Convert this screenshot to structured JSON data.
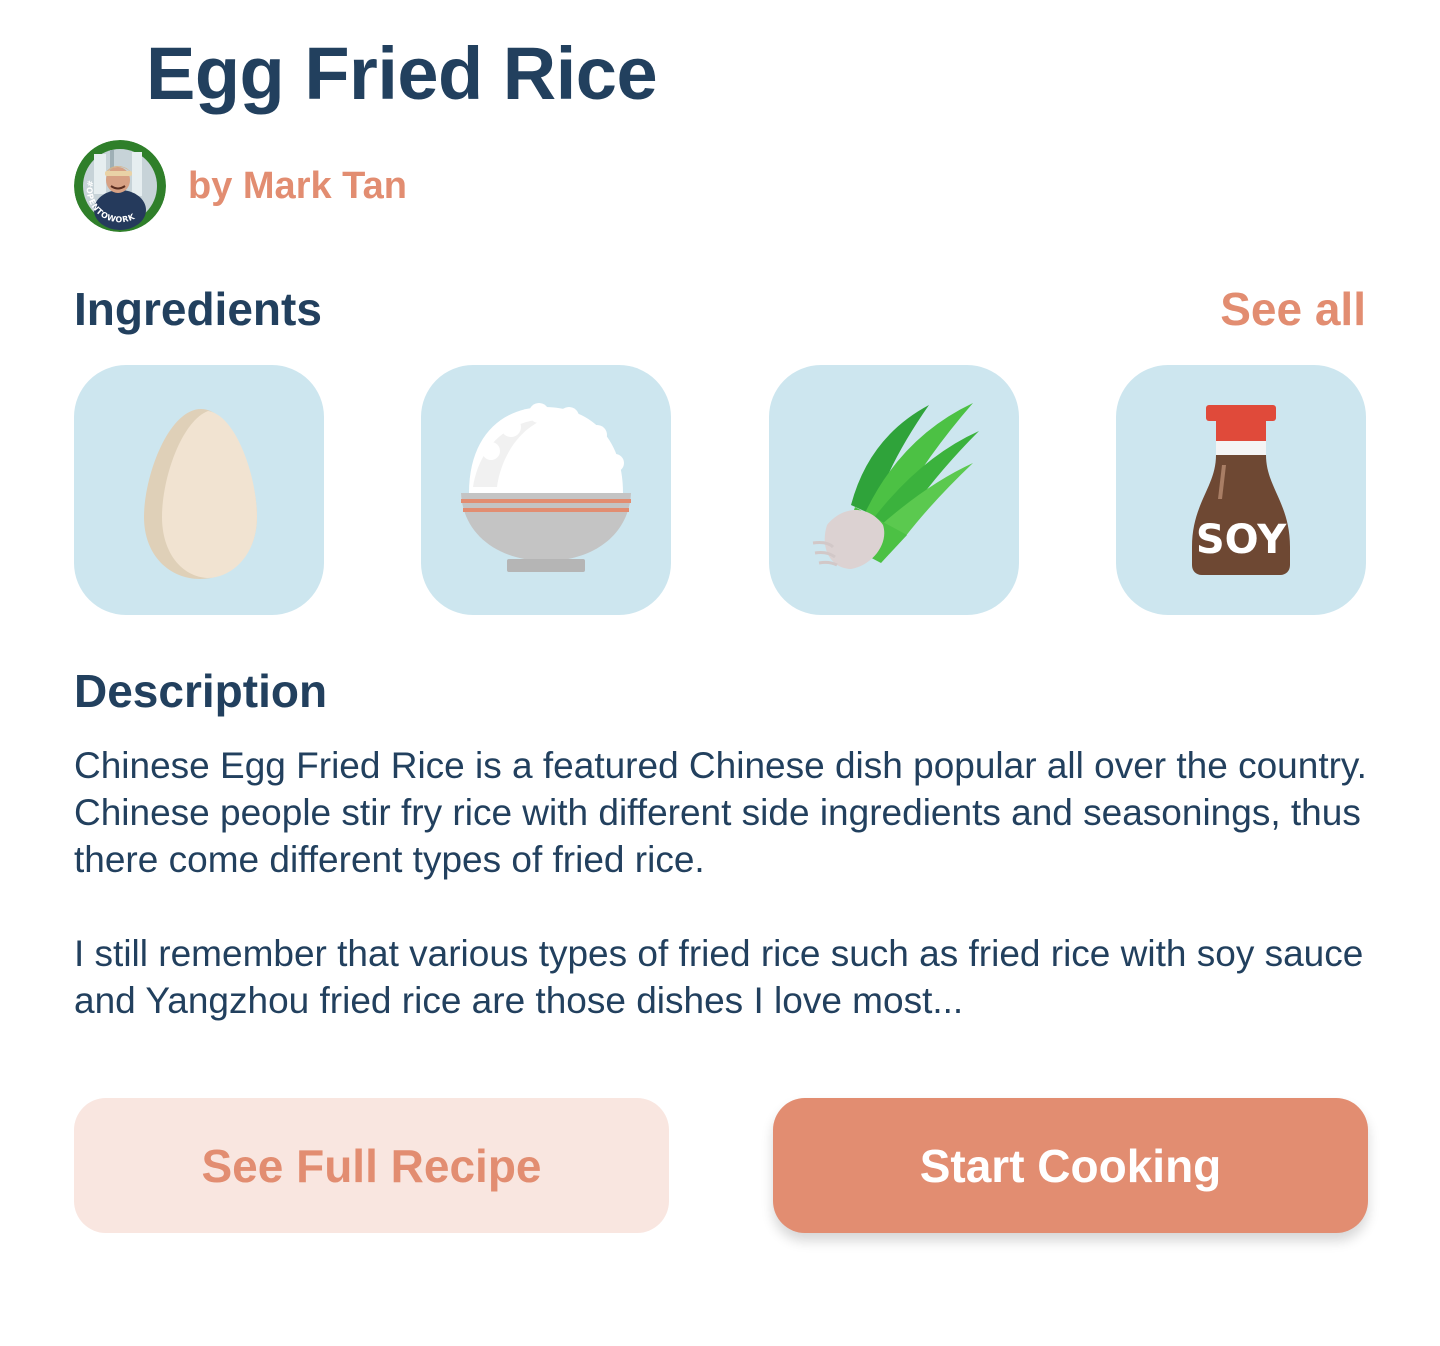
{
  "recipe": {
    "title": "Egg Fried Rice",
    "author": "by Mark Tan",
    "avatar_badge": "#OPENTOWORK"
  },
  "ingredients": {
    "heading": "Ingredients",
    "see_all": "See all",
    "items": [
      {
        "icon": "egg-icon"
      },
      {
        "icon": "rice-bowl-icon"
      },
      {
        "icon": "scallion-icon"
      },
      {
        "icon": "soy-sauce-icon",
        "label": "SOY"
      }
    ]
  },
  "description": {
    "heading": "Description",
    "paragraphs": [
      "Chinese Egg Fried Rice is a featured Chinese dish popular all over the country. Chinese people stir fry rice with different side ingredients and seasonings, thus there come different types of fried rice.",
      "I still remember that various types of fried rice such as fried rice with soy sauce and Yangzhou fried rice are those dishes I love most..."
    ]
  },
  "actions": {
    "secondary_label": "See Full Recipe",
    "primary_label": "Start Cooking"
  },
  "colors": {
    "heading": "#22405e",
    "accent": "#e28d71",
    "tile_bg": "#cde6ef",
    "secondary_btn_bg": "#f9e6e0",
    "avatar_ring": "#2f7f2a"
  }
}
